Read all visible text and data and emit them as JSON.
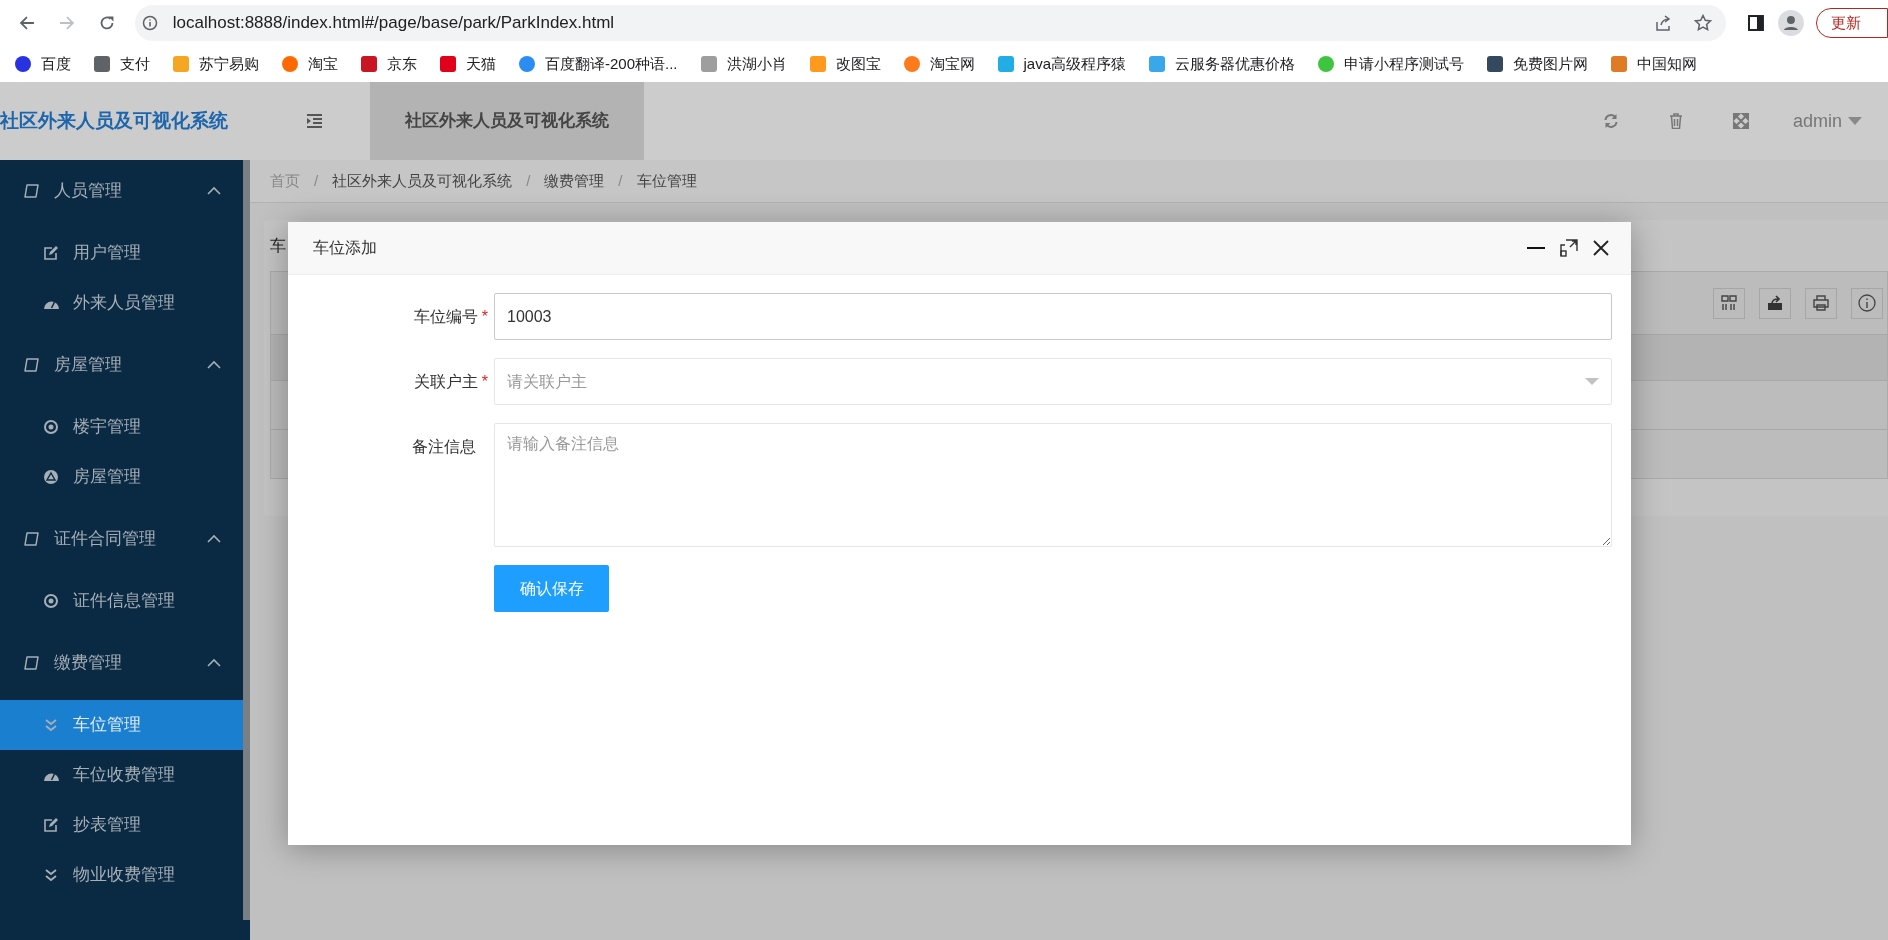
{
  "browser": {
    "url": "localhost:8888/index.html#/page/base/park/ParkIndex.html",
    "update_button": "更新",
    "bookmarks": [
      {
        "label": "百度",
        "color": "#2932e1"
      },
      {
        "label": "支付",
        "color": "#5f6368"
      },
      {
        "label": "苏宁易购",
        "color": "#f5a623"
      },
      {
        "label": "淘宝",
        "color": "#ff6a00"
      },
      {
        "label": "京东",
        "color": "#c91623"
      },
      {
        "label": "天猫",
        "color": "#e0001b"
      },
      {
        "label": "百度翻译-200种语...",
        "color": "#2b8cf2"
      },
      {
        "label": "洪湖小肖",
        "color": "#9e9e9e"
      },
      {
        "label": "改图宝",
        "color": "#ff9a1f"
      },
      {
        "label": "淘宝网",
        "color": "#ff7a1a"
      },
      {
        "label": "java高级程序猿",
        "color": "#23ade5"
      },
      {
        "label": "云服务器优惠价格",
        "color": "#3aa7e8"
      },
      {
        "label": "申请小程序测试号",
        "color": "#3fc43f"
      },
      {
        "label": "免费图片网",
        "color": "#34495e"
      },
      {
        "label": "中国知网",
        "color": "#e07b25"
      }
    ]
  },
  "app": {
    "logo": "社区外来人员及可视化系统",
    "tab": {
      "label": "社区外来人员及可视化系统",
      "selected": true
    },
    "user": "admin",
    "breadcrumb": [
      {
        "label": "首页"
      },
      {
        "separator": "/",
        "label": "社区外来人员及可视化系统"
      },
      {
        "separator": "/",
        "label": "缴费管理"
      },
      {
        "separator": "/",
        "label": "车位管理"
      }
    ],
    "sidebar": [
      {
        "label": "人员管理",
        "expanded": true,
        "children": [
          {
            "label": "用户管理",
            "selected": false
          },
          {
            "label": "外来人员管理",
            "selected": false
          }
        ]
      },
      {
        "label": "房屋管理",
        "expanded": true,
        "children": [
          {
            "label": "楼宇管理",
            "selected": false
          },
          {
            "label": "房屋管理",
            "selected": false
          }
        ]
      },
      {
        "label": "证件合同管理",
        "expanded": true,
        "children": [
          {
            "label": "证件信息管理",
            "selected": false
          }
        ]
      },
      {
        "label": "缴费管理",
        "expanded": true,
        "children": [
          {
            "label": "车位管理",
            "selected": true
          },
          {
            "label": "车位收费管理",
            "selected": false
          },
          {
            "label": "抄表管理",
            "selected": false
          },
          {
            "label": "物业收费管理",
            "selected": false
          }
        ]
      }
    ],
    "card_title": "车"
  },
  "modal": {
    "title": "车位添加",
    "fields": [
      {
        "kind": "input",
        "label": "车位编号",
        "required_mark": "*",
        "value": "10003"
      },
      {
        "kind": "select",
        "label": "关联户主",
        "required_mark": "*",
        "placeholder": "请关联户主"
      },
      {
        "kind": "textarea",
        "label": "备注信息",
        "placeholder": "请输入备注信息"
      }
    ],
    "button": "确认保存"
  }
}
